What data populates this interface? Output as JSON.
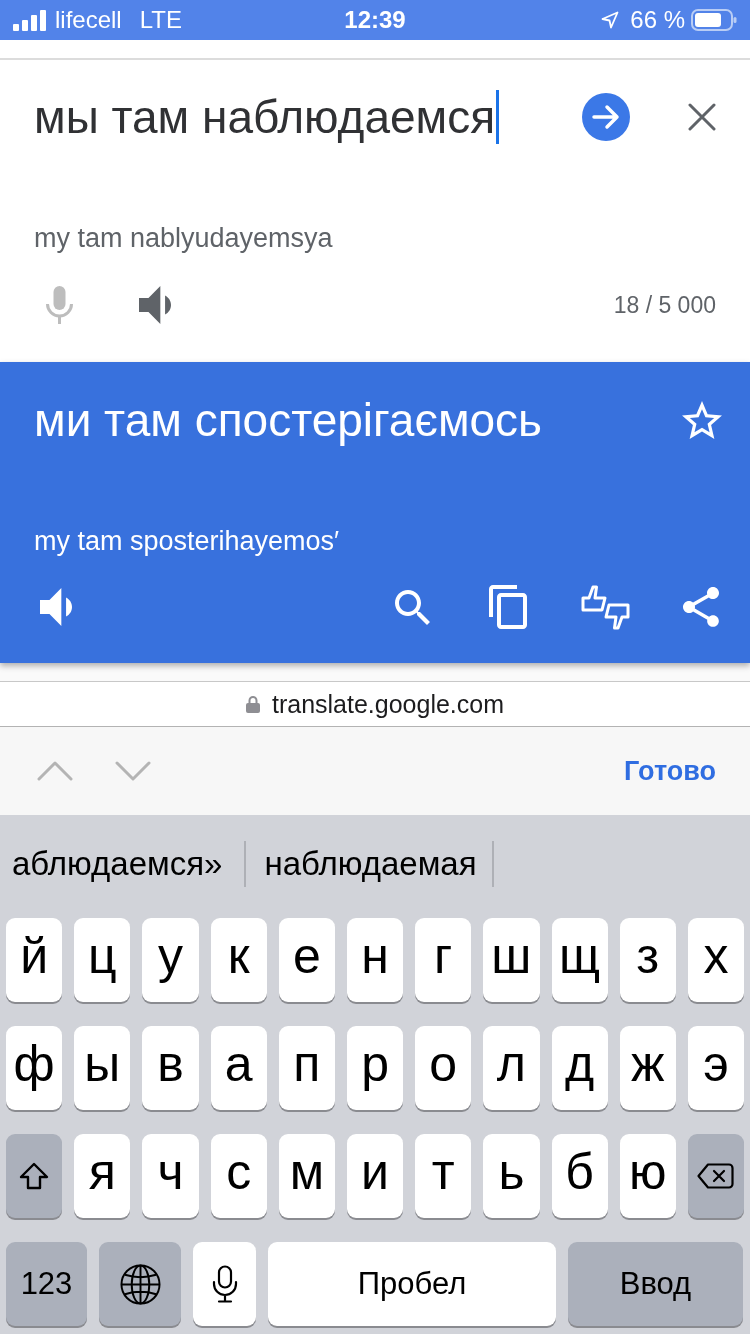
{
  "status_bar": {
    "carrier": "lifecell",
    "network": "LTE",
    "time": "12:39",
    "battery": "66 %"
  },
  "source": {
    "text": "мы там наблюдаемся",
    "transliteration": "my tam nablyudayemsya",
    "character_count": "18 / 5 000",
    "mic": {
      "disabled": true
    }
  },
  "translation": {
    "text": "ми там спостерігаємось",
    "transliteration": "my tam sposterihayemos′",
    "starred": false
  },
  "browser": {
    "url": "translate.google.com"
  },
  "keyboard_toolbar": {
    "done": "Готово"
  },
  "keyboard": {
    "suggestions": [
      "аблюдаемся»",
      "наблюдаемая"
    ],
    "letter_rows": [
      [
        {
          "kind": "letter",
          "label": "й"
        },
        {
          "kind": "letter",
          "label": "ц"
        },
        {
          "kind": "letter",
          "label": "у"
        },
        {
          "kind": "letter",
          "label": "к"
        },
        {
          "kind": "letter",
          "label": "е"
        },
        {
          "kind": "letter",
          "label": "н"
        },
        {
          "kind": "letter",
          "label": "г"
        },
        {
          "kind": "letter",
          "label": "ш"
        },
        {
          "kind": "letter",
          "label": "щ"
        },
        {
          "kind": "letter",
          "label": "з"
        },
        {
          "kind": "letter",
          "label": "х"
        }
      ],
      [
        {
          "kind": "letter",
          "label": "ф"
        },
        {
          "kind": "letter",
          "label": "ы"
        },
        {
          "kind": "letter",
          "label": "в"
        },
        {
          "kind": "letter",
          "label": "а"
        },
        {
          "kind": "letter",
          "label": "п"
        },
        {
          "kind": "letter",
          "label": "р"
        },
        {
          "kind": "letter",
          "label": "о"
        },
        {
          "kind": "letter",
          "label": "л"
        },
        {
          "kind": "letter",
          "label": "д"
        },
        {
          "kind": "letter",
          "label": "ж"
        },
        {
          "kind": "letter",
          "label": "э"
        }
      ],
      [
        {
          "kind": "shift"
        },
        {
          "kind": "letter",
          "label": "я"
        },
        {
          "kind": "letter",
          "label": "ч"
        },
        {
          "kind": "letter",
          "label": "с"
        },
        {
          "kind": "letter",
          "label": "м"
        },
        {
          "kind": "letter",
          "label": "и"
        },
        {
          "kind": "letter",
          "label": "т"
        },
        {
          "kind": "letter",
          "label": "ь"
        },
        {
          "kind": "letter",
          "label": "б"
        },
        {
          "kind": "letter",
          "label": "ю"
        },
        {
          "kind": "backspace"
        }
      ]
    ],
    "bottom_row": [
      {
        "kind": "numbers",
        "label": "123"
      },
      {
        "kind": "globe"
      },
      {
        "kind": "dictation"
      },
      {
        "kind": "space",
        "label": "Пробел"
      },
      {
        "kind": "return",
        "label": "Ввод"
      }
    ]
  }
}
